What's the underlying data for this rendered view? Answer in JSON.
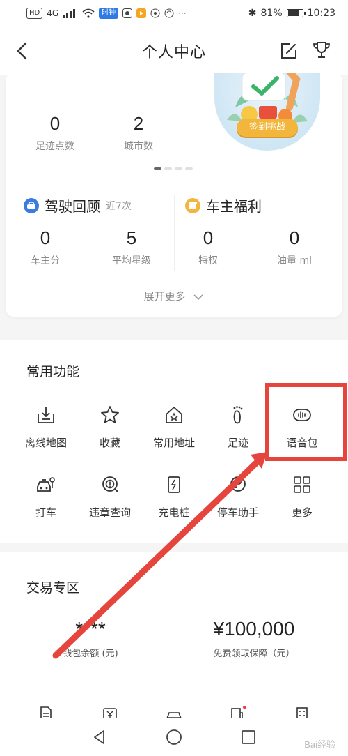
{
  "status_bar": {
    "indicators": [
      "HD",
      "4G",
      "all"
    ],
    "app_chip": "时钟",
    "more": "···",
    "bluetooth": "✱",
    "battery": "81%",
    "battery_level": 0.81,
    "time": "10:23"
  },
  "navbar": {
    "title": "个人中心",
    "back_icon": "chevron-left-icon",
    "edit_icon": "edit-icon",
    "trophy_icon": "trophy-icon"
  },
  "stats": {
    "footprints": {
      "value": "0",
      "label": "足迹点数"
    },
    "cities": {
      "value": "2",
      "label": "城市数"
    },
    "challenge_button": "签到挑战",
    "pager_pages": 4,
    "pager_active": 0
  },
  "driving": {
    "title": "驾驶回顾",
    "subtitle": "近7次",
    "owner_score": {
      "value": "0",
      "label": "车主分"
    },
    "avg_stars": {
      "value": "5",
      "label": "平均星级"
    }
  },
  "benefits": {
    "title": "车主福利",
    "privileges": {
      "value": "0",
      "label": "特权"
    },
    "fuel": {
      "value": "0",
      "label": "油量 ml"
    }
  },
  "expand_more": "展开更多",
  "common_functions": {
    "title": "常用功能",
    "items": [
      {
        "label": "离线地图",
        "icon": "offline-map-icon"
      },
      {
        "label": "收藏",
        "icon": "star-icon"
      },
      {
        "label": "常用地址",
        "icon": "home-star-icon"
      },
      {
        "label": "足迹",
        "icon": "footprint-icon"
      },
      {
        "label": "语音包",
        "icon": "voice-pack-icon"
      },
      {
        "label": "打车",
        "icon": "taxi-icon"
      },
      {
        "label": "违章查询",
        "icon": "violation-query-icon"
      },
      {
        "label": "充电桩",
        "icon": "charging-pile-icon"
      },
      {
        "label": "停车助手",
        "icon": "parking-icon"
      },
      {
        "label": "更多",
        "icon": "grid-icon"
      }
    ]
  },
  "trade_zone": {
    "title": "交易专区",
    "wallet": {
      "value": "****",
      "label": "钱包余额 (元)"
    },
    "protection": {
      "value": "¥100,000",
      "label": "免费领取保障（元）"
    }
  },
  "watermark": "Bai经验",
  "colors": {
    "highlight": "#e5453c",
    "accent_blue": "#3c7be0",
    "accent_orange": "#f2b63c"
  }
}
